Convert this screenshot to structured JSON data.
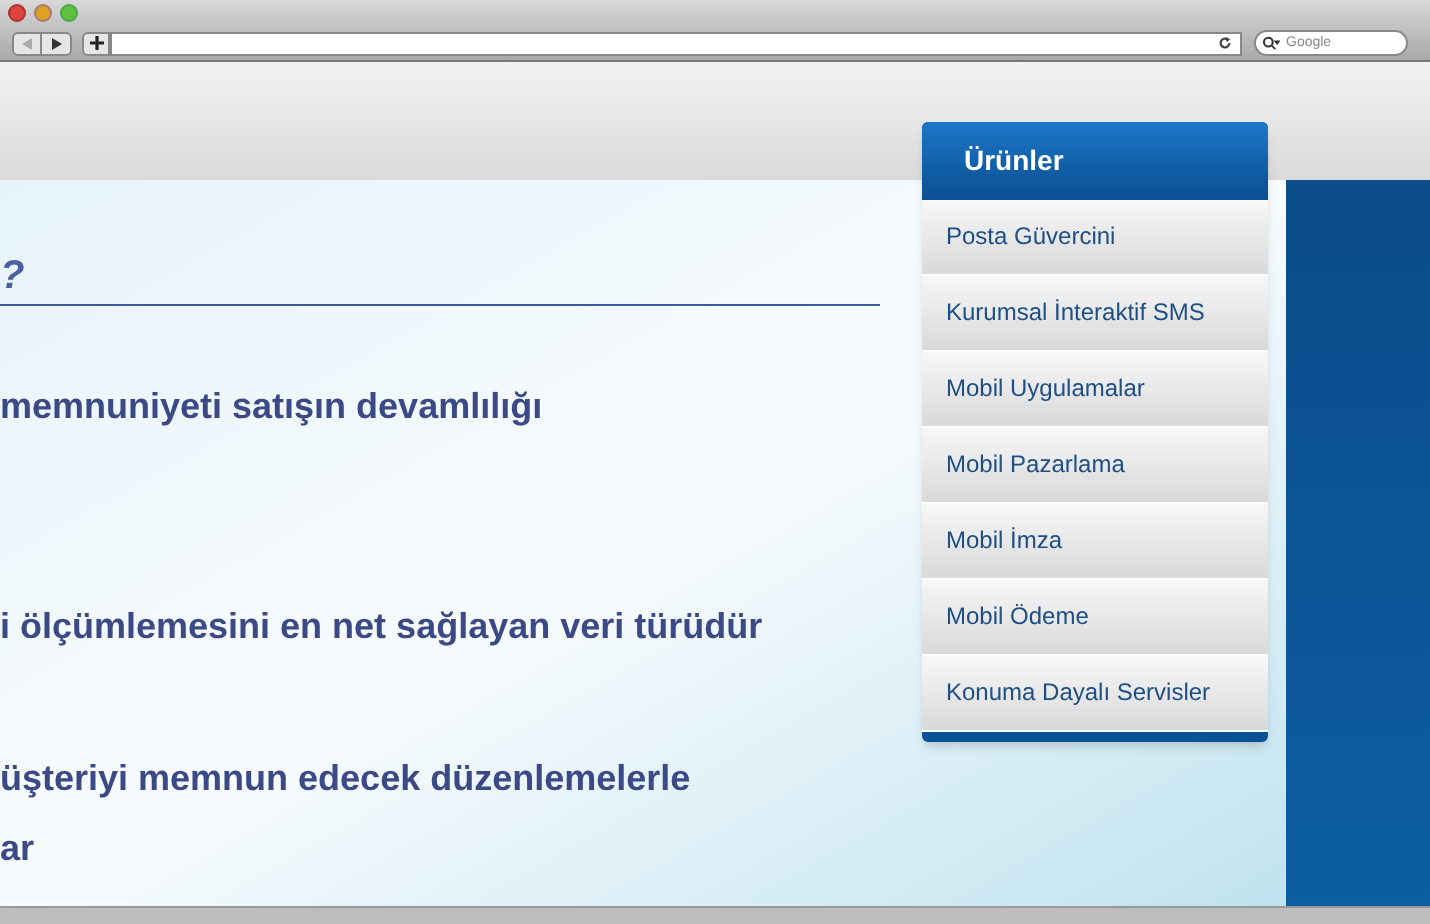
{
  "browser": {
    "search_placeholder": "Google"
  },
  "slide": {
    "heading": "?",
    "lines": [
      "memnuniyeti satışın devamlılığı",
      "i ölçümlemesini en net sağlayan veri türüdür",
      "üşteriyi memnun edecek düzenlemelerle",
      "ar"
    ]
  },
  "products_menu": {
    "title": "Ürünler",
    "items": [
      "Posta Güvercini",
      "Kurumsal İnteraktif SMS",
      "Mobil Uygulamalar",
      "Mobil Pazarlama",
      "Mobil İmza",
      "Mobil Ödeme",
      "Konuma Dayalı Servisler"
    ]
  }
}
